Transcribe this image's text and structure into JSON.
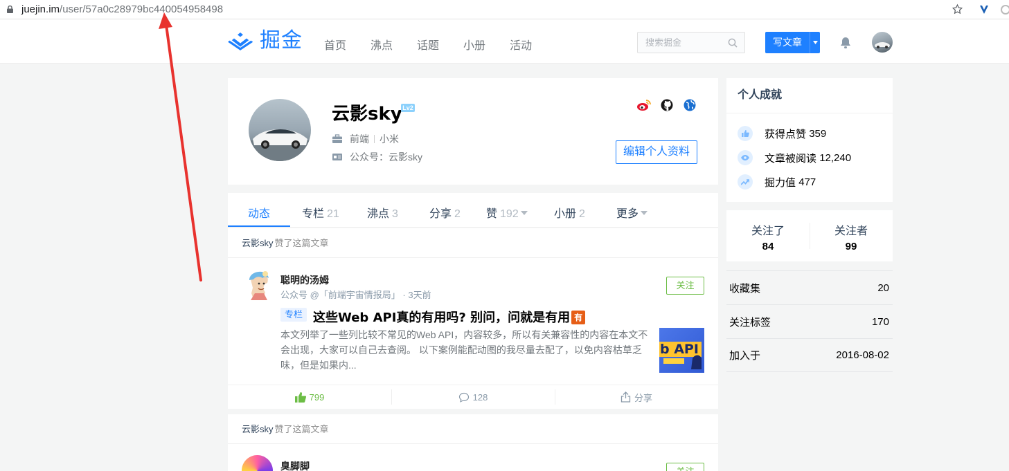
{
  "browser": {
    "url_host": "juejin.im",
    "url_path": "/user/57a0c28979bc440054958498"
  },
  "header": {
    "logo_text": "掘金",
    "nav": [
      "首页",
      "沸点",
      "话题",
      "小册",
      "活动"
    ],
    "search_placeholder": "搜索掘金",
    "write_label": "写文章",
    "brand_color": "#1e80ff"
  },
  "profile": {
    "username": "云影sky",
    "level": "Lv2",
    "job": "前端",
    "company": "小米",
    "bio": "公众号：云影sky",
    "edit_label": "编辑个人资料",
    "icons": [
      "weibo-icon",
      "github-icon",
      "globe-icon"
    ]
  },
  "tabs": [
    {
      "label": "动态",
      "count": ""
    },
    {
      "label": "专栏",
      "count": "21"
    },
    {
      "label": "沸点",
      "count": "3"
    },
    {
      "label": "分享",
      "count": "2"
    },
    {
      "label": "赞",
      "count": "192"
    },
    {
      "label": "小册",
      "count": "2"
    },
    {
      "label": "更多",
      "count": ""
    }
  ],
  "feed": [
    {
      "actor": "云影sky",
      "action": "赞了这篇文章",
      "author": "聪明的汤姆",
      "author_meta": "公众号 @「前端宇宙情报局」 · 3天前",
      "follow_label": "关注",
      "tag": "专栏",
      "title": "这些Web API真的有用吗? 别问，问就是有用",
      "badge": "有",
      "summary": "本文列举了一些列比较不常见的Web API，内容较多，所以有关兼容性的内容在本文不会出现，大家可以自己去查阅。 以下案例能配动图的我尽量去配了，以免内容枯草乏味，但是如果内...",
      "thumb_text": "b API",
      "likes": "799",
      "comments": "128",
      "share_label": "分享"
    },
    {
      "actor": "云影sky",
      "action": "赞了这篇文章",
      "author": "臭脚脚",
      "follow_label": "关注"
    }
  ],
  "sidebar": {
    "achievements_title": "个人成就",
    "achievements": [
      {
        "label": "获得点赞",
        "value": "359"
      },
      {
        "label": "文章被阅读",
        "value": "12,240"
      },
      {
        "label": "掘力值",
        "value": "477"
      }
    ],
    "following_label": "关注了",
    "following_count": "84",
    "followers_label": "关注者",
    "followers_count": "99",
    "list": [
      {
        "label": "收藏集",
        "value": "20"
      },
      {
        "label": "关注标签",
        "value": "170"
      },
      {
        "label": "加入于",
        "value": "2016-08-02"
      }
    ]
  }
}
